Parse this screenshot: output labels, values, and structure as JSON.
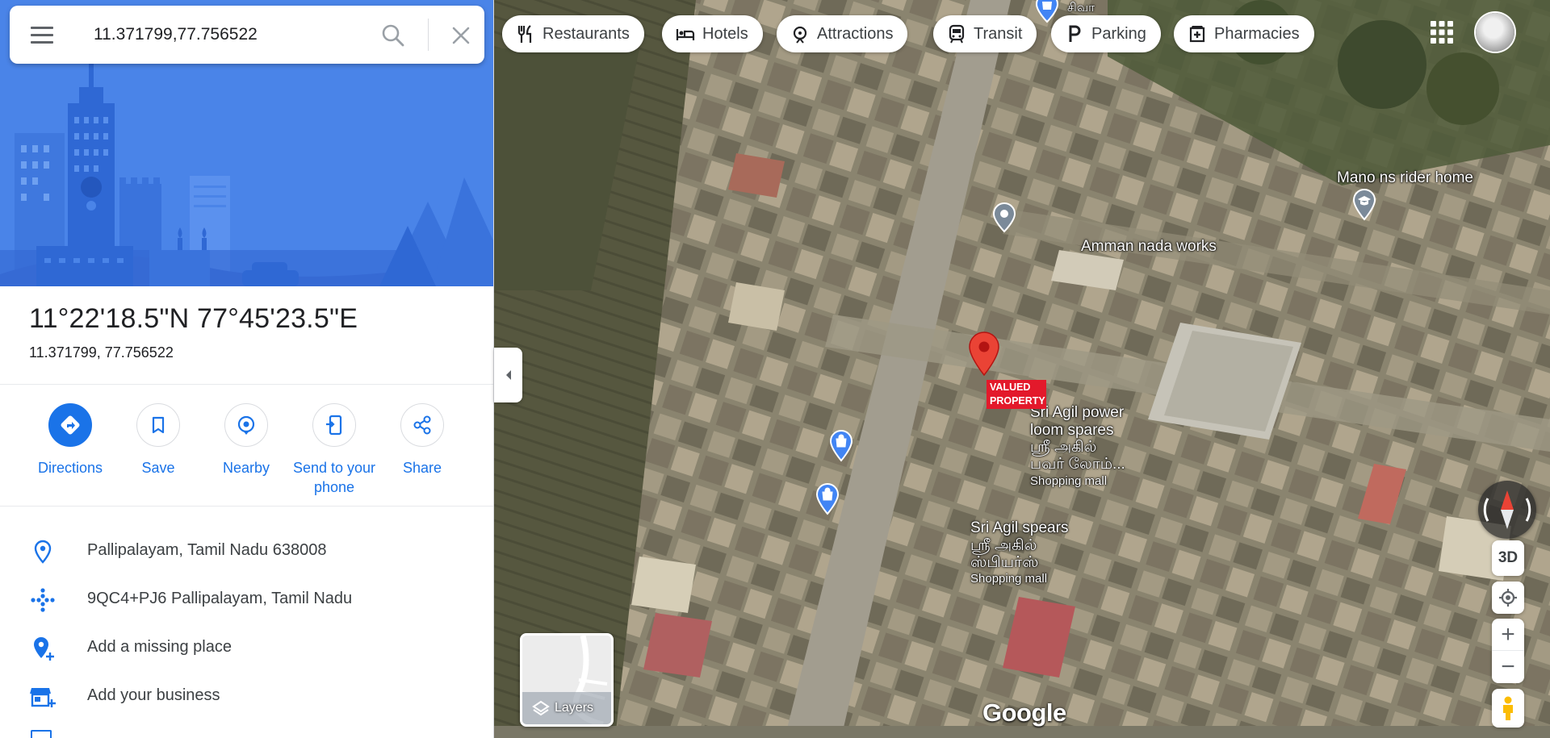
{
  "search": {
    "value": "11.371799,77.756522"
  },
  "place": {
    "title": "11°22'18.5\"N 77°45'23.5\"E",
    "subtitle": "11.371799, 77.756522"
  },
  "actions": [
    {
      "label": "Directions",
      "icon": "directions-icon"
    },
    {
      "label": "Save",
      "icon": "bookmark-icon"
    },
    {
      "label": "Nearby",
      "icon": "nearby-icon"
    },
    {
      "label": "Send to your phone",
      "icon": "send-to-phone-icon"
    },
    {
      "label": "Share",
      "icon": "share-icon"
    }
  ],
  "info_rows": [
    {
      "text": "Pallipalayam, Tamil Nadu 638008",
      "icon": "location-pin-icon"
    },
    {
      "text": "9QC4+PJ6 Pallipalayam, Tamil Nadu",
      "icon": "plus-code-icon"
    },
    {
      "text": "Add a missing place",
      "icon": "add-place-icon"
    },
    {
      "text": "Add your business",
      "icon": "add-business-icon"
    }
  ],
  "chips": [
    {
      "label": "Restaurants",
      "icon": "restaurant-icon"
    },
    {
      "label": "Hotels",
      "icon": "hotel-icon"
    },
    {
      "label": "Attractions",
      "icon": "attractions-icon"
    },
    {
      "label": "Transit",
      "icon": "transit-icon"
    },
    {
      "label": "Parking",
      "icon": "parking-icon"
    },
    {
      "label": "Pharmacies",
      "icon": "pharmacy-icon"
    }
  ],
  "map": {
    "labels": {
      "top_partial": "சிவா",
      "mano": "Mano ns rider home",
      "amman": "Amman nada works",
      "valued": "VALUED PROPERTY",
      "agil_power_1": "Sri Agil power",
      "agil_power_2": "loom spares",
      "agil_power_tamil_1": "ஸ்ரீ அகில்",
      "agil_power_tamil_2": "பவர் லோம்...",
      "agil_power_cat": "Shopping mall",
      "agil_spears": "Sri Agil spears",
      "agil_spears_tamil_1": "ஸ்ரீ அகில்",
      "agil_spears_tamil_2": "ஸ்பியர்ஸ்",
      "agil_spears_cat": "Shopping mall"
    },
    "layers_label": "Layers",
    "logo": "Google",
    "btn_3d": "3D",
    "zoom_in": "+",
    "zoom_out": "−"
  },
  "colors": {
    "accent": "#1a73e8",
    "pin": "#ea4335",
    "hero": "#4a84e8",
    "poi_blue": "#4285f4"
  }
}
